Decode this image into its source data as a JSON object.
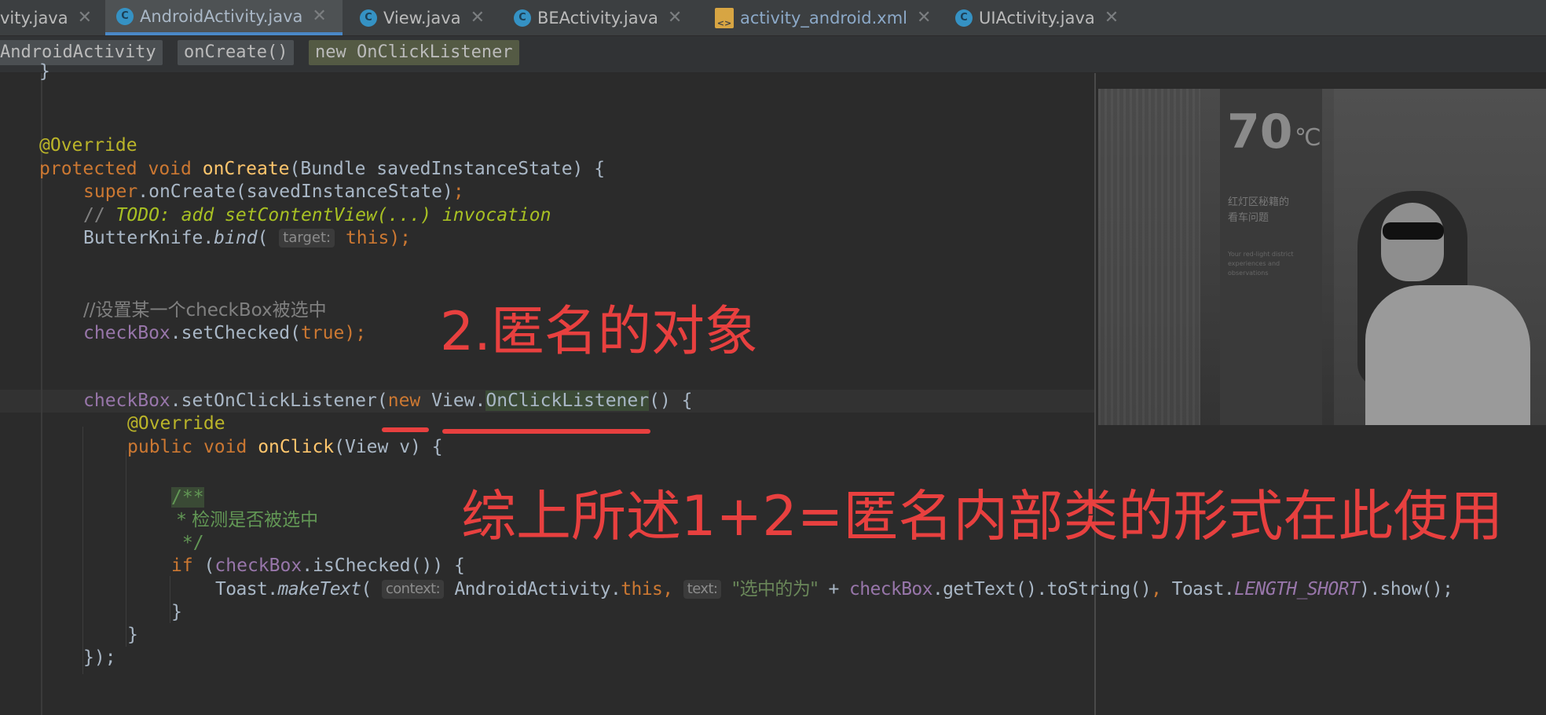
{
  "tabs": [
    {
      "label": "vity.java",
      "icon": "class-icon"
    },
    {
      "label": "AndroidActivity.java",
      "icon": "class-icon",
      "active": true
    },
    {
      "label": "View.java",
      "icon": "class-icon"
    },
    {
      "label": "BEActivity.java",
      "icon": "class-icon"
    },
    {
      "label": "activity_android.xml",
      "icon": "xml-file-icon"
    },
    {
      "label": "UIActivity.java",
      "icon": "class-icon"
    }
  ],
  "tab_icon_letter": "C",
  "xml_icon_text": "<>",
  "close_glyph": "✕",
  "breadcrumb": [
    "AndroidActivity",
    "onCreate()",
    "new OnClickListener"
  ],
  "code": {
    "l0_brace": "}",
    "l1_annotation": "@Override",
    "l2_protected": "protected",
    "l2_void": "void",
    "l2_method": "onCreate",
    "l2_params": "(Bundle savedInstanceState) {",
    "l3_super": "super",
    "l3_call": ".onCreate(savedInstanceState)",
    "l3_semi": ";",
    "l4_slashes": "// ",
    "l4_todo": "TODO: add setContentView(...) invocation",
    "l5_butterknife": "ButterKnife.",
    "l5_bind": "bind",
    "l5_paren": "(",
    "l5_hint": "target:",
    "l5_this": "this",
    "l5_end": ");",
    "l6_comment": "//设置某一个checkBox被选中",
    "l7_checkbox": "checkBox",
    "l7_call": ".setChecked(",
    "l7_true": "true",
    "l7_end": ");",
    "l8_checkbox": "checkBox",
    "l8_call": ".setOnClickListener(",
    "l8_new": "new",
    "l8_view": "View.",
    "l8_listener": "OnClickListener",
    "l8_end": "() {",
    "l9_annotation": "@Override",
    "l10_public": "public",
    "l10_void": "void",
    "l10_method": "onClick",
    "l10_params": "(View v) {",
    "l11_doc_open": "/**",
    "l12_doc": " * 检测是否被选中",
    "l13_doc_close": " */",
    "l14_if": "if",
    "l14_open": " (",
    "l14_checkbox": "checkBox",
    "l14_call": ".isChecked()) {",
    "l15_toast": "Toast.",
    "l15_maketext": "makeText",
    "l15_paren": "(",
    "l15_hint_context": "context:",
    "l15_activity": "AndroidActivity.",
    "l15_this": "this",
    "l15_comma": ",",
    "l15_hint_text": "text:",
    "l15_string": "\"选中的为\"",
    "l15_plus": " + ",
    "l15_checkbox": "checkBox",
    "l15_rest": ".getText().toString()",
    "l15_comma2": ",",
    "l15_toast2": " Toast.",
    "l15_length": "LENGTH_SHORT",
    "l15_end": ").show();",
    "l16_brace": "}",
    "l17_brace": "}",
    "l18_end": "});"
  },
  "photo": {
    "temperature": "70",
    "unit": "℃",
    "sign_text": "红灯区秘籍的\n看车问题",
    "sign_small": "Your red-light district\nexperiences and\nobservations"
  },
  "annotations": {
    "note_anonymous_object": "2.匿名的对象",
    "note_summary": "综上所述1+2=匿名内部类的形式在此使用"
  },
  "colors": {
    "background": "#2b2b2b",
    "keyword": "#cc7832",
    "annotation_red": "#e8403f",
    "active_tab_underline": "#4a88c7"
  }
}
